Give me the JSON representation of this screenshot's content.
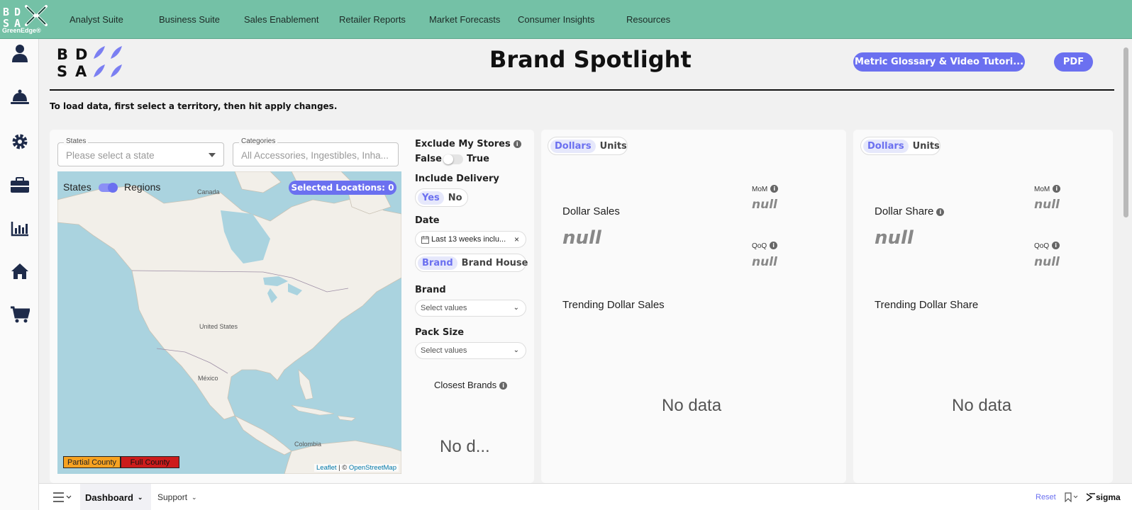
{
  "brand": {
    "logo_letters": [
      "B",
      "D",
      "S",
      "A"
    ],
    "logo_sub": "GreenEdge®",
    "accent": "#6b70f0",
    "nav_bg": "#74c1a6"
  },
  "topnav": {
    "items": [
      "Analyst Suite",
      "Business Suite",
      "Sales Enablement",
      "Retailer Reports",
      "Market Forecasts",
      "Consumer Insights",
      "Resources"
    ]
  },
  "sidebar": {
    "icons": [
      "user-icon",
      "bell-service-icon",
      "gear-icon",
      "briefcase-icon",
      "bar-chart-icon",
      "home-icon",
      "cart-icon"
    ]
  },
  "header": {
    "title": "Brand Spotlight",
    "glossary_button": "Metric Glossary & Video Tutori...",
    "pdf_button": "PDF",
    "instructions": "To load data, first select a territory, then hit apply changes."
  },
  "filters": {
    "states_label": "States",
    "states_placeholder": "Please select a state",
    "categories_label": "Categories",
    "categories_placeholder": "All Accessories, Ingestibles, Inha..."
  },
  "map": {
    "toggle_left": "States",
    "toggle_right": "Regions",
    "selected_locations": "Selected Locations: 0",
    "labels": {
      "canada": "Canada",
      "us": "United States",
      "mexico": "México",
      "colombia": "Colombia"
    },
    "legend_partial": "Partial County",
    "legend_full": "Full County",
    "attribution_leaflet": "Leaflet",
    "attribution_sep": " | © ",
    "attribution_osm": "OpenStreetMap"
  },
  "controls": {
    "exclude_label": "Exclude My Stores",
    "false_label": "False",
    "true_label": "True",
    "delivery_label": "Include Delivery",
    "delivery_yes": "Yes",
    "delivery_no": "No",
    "date_label": "Date",
    "date_value": "Last 13 weeks inclu...",
    "brand_toggle": "Brand",
    "brand_house_toggle": "Brand House",
    "brand_label": "Brand",
    "brand_placeholder": "Select values",
    "pack_label": "Pack Size",
    "pack_placeholder": "Select values",
    "closest_brands": "Closest Brands",
    "closest_nodata": "No d..."
  },
  "sales_card": {
    "toggle_dollars": "Dollars",
    "toggle_units": "Units",
    "title": "Dollar Sales",
    "value": "null",
    "mom_label": "MoM",
    "mom_value": "null",
    "qoq_label": "QoQ",
    "qoq_value": "null",
    "trend_title": "Trending Dollar Sales",
    "nodata": "No data"
  },
  "share_card": {
    "toggle_dollars": "Dollars",
    "toggle_units": "Units",
    "title": "Dollar Share",
    "value": "null",
    "mom_label": "MoM",
    "mom_value": "null",
    "qoq_label": "QoQ",
    "qoq_value": "null",
    "trend_title": "Trending Dollar Share",
    "nodata": "No data"
  },
  "bottombar": {
    "dashboard": "Dashboard",
    "support": "Support",
    "reset": "Reset",
    "sigma": "sigma"
  }
}
